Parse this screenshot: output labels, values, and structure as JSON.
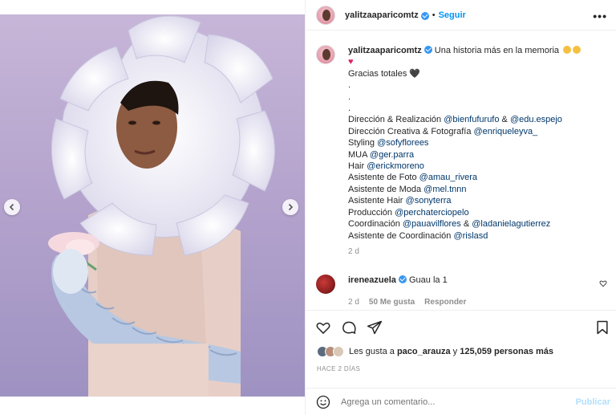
{
  "post": {
    "username": "yalitzaaparicomtz",
    "follow_label": "Seguir",
    "more_label": "•••",
    "caption_header": "Una historia más en la memoria",
    "caption_lines": [
      {
        "text": "Gracias totales ",
        "mentions": [],
        "suffix": "🖤"
      },
      {
        "text": ".",
        "mentions": []
      },
      {
        "text": ".",
        "mentions": []
      },
      {
        "text": ".",
        "mentions": []
      },
      {
        "text": "Dirección & Realización ",
        "mentions": [
          "@bienfufurufo",
          " & ",
          "@edu.espejo"
        ]
      },
      {
        "text": "Dirección Creativa & Fotografía ",
        "mentions": [
          "@enriqueleyva_"
        ]
      },
      {
        "text": "Styling ",
        "mentions": [
          "@sofyflorees"
        ]
      },
      {
        "text": "MUA ",
        "mentions": [
          "@ger.parra"
        ]
      },
      {
        "text": "Hair ",
        "mentions": [
          "@erickmoreno"
        ]
      },
      {
        "text": "Asistente de Foto ",
        "mentions": [
          "@amau_rivera"
        ]
      },
      {
        "text": "Asistente de Moda ",
        "mentions": [
          "@mel.tnnn"
        ]
      },
      {
        "text": "Asistente Hair ",
        "mentions": [
          "@sonyterra"
        ]
      },
      {
        "text": "Producción ",
        "mentions": [
          "@perchaterciopelo"
        ]
      },
      {
        "text": "Coordinación ",
        "mentions": [
          "@pauavilflores",
          " & ",
          "@ladanielagutierrez"
        ]
      },
      {
        "text": "Asistente de Coordinación ",
        "mentions": [
          "@rislasd"
        ]
      }
    ],
    "caption_time": "2 d"
  },
  "comment": {
    "username": "ireneazuela",
    "text": "Guau la 1",
    "time": "2 d",
    "likes": "50 Me gusta",
    "reply_label": "Responder"
  },
  "likes": {
    "text_prefix": "Les gusta a ",
    "user": "paco_arauza",
    "middle": " y ",
    "count": "125,059 personas más"
  },
  "ago": "HACE 2 DÍAS",
  "add_comment": {
    "placeholder": "Agrega un comentario...",
    "publish_label": "Publicar"
  },
  "carousel": {
    "total": 7,
    "active_index": 0
  },
  "colors": {
    "accent": "#0095f6",
    "mention": "#00376b",
    "muted": "#8e8e8e"
  }
}
